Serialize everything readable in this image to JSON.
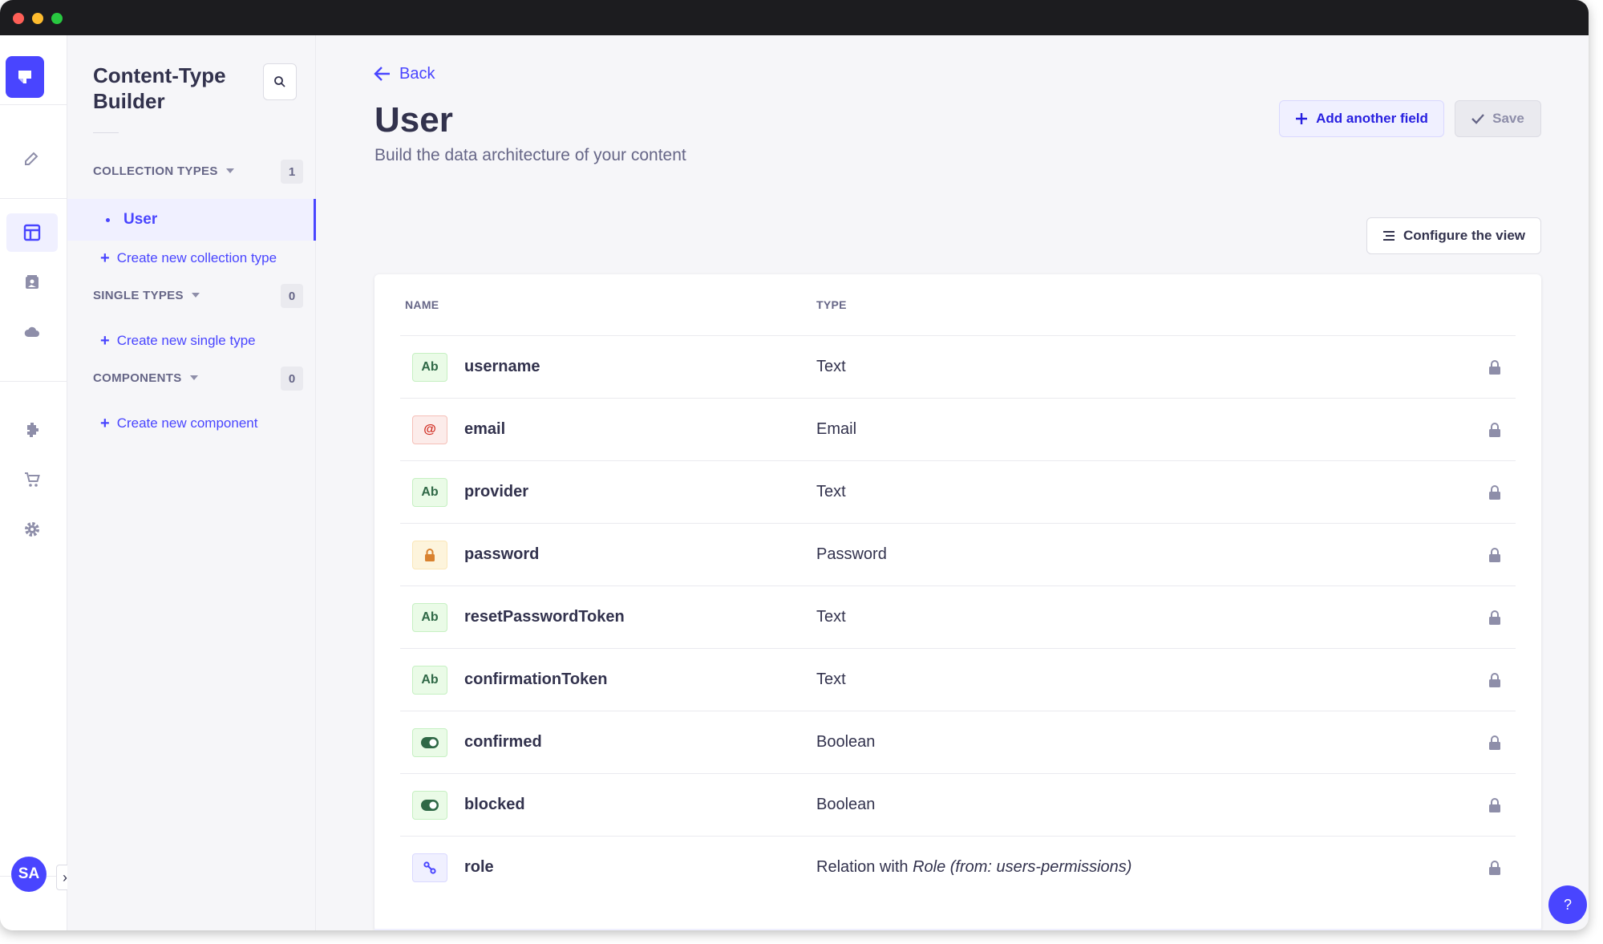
{
  "app": {
    "avatar_initials": "SA",
    "accent": "#4945ff"
  },
  "subnav": {
    "title": "Content-Type Builder",
    "sections": [
      {
        "label": "COLLECTION TYPES",
        "count": "1",
        "create_label": "Create new collection type"
      },
      {
        "label": "SINGLE TYPES",
        "count": "0",
        "create_label": "Create new single type"
      },
      {
        "label": "COMPONENTS",
        "count": "0",
        "create_label": "Create new component"
      }
    ],
    "active_item": "User"
  },
  "header": {
    "back_label": "Back",
    "title": "User",
    "subtitle": "Build the data architecture of your content",
    "add_field_label": "Add another field",
    "save_label": "Save",
    "configure_label": "Configure the view"
  },
  "table": {
    "columns": [
      "NAME",
      "TYPE"
    ],
    "rows": [
      {
        "name": "username",
        "type": "Text",
        "icon": "text-icon"
      },
      {
        "name": "email",
        "type": "Email",
        "icon": "email-icon"
      },
      {
        "name": "provider",
        "type": "Text",
        "icon": "text-icon"
      },
      {
        "name": "password",
        "type": "Password",
        "icon": "password-icon"
      },
      {
        "name": "resetPasswordToken",
        "type": "Text",
        "icon": "text-icon"
      },
      {
        "name": "confirmationToken",
        "type": "Text",
        "icon": "text-icon"
      },
      {
        "name": "confirmed",
        "type": "Boolean",
        "icon": "boolean-icon"
      },
      {
        "name": "blocked",
        "type": "Boolean",
        "icon": "boolean-icon"
      },
      {
        "name": "role",
        "type_prefix": "Relation with ",
        "type_italic": "Role (from: users-permissions)",
        "icon": "relation-icon"
      }
    ],
    "badge_text": "Ab",
    "email_badge_text": "@"
  },
  "help": {
    "label": "?"
  }
}
